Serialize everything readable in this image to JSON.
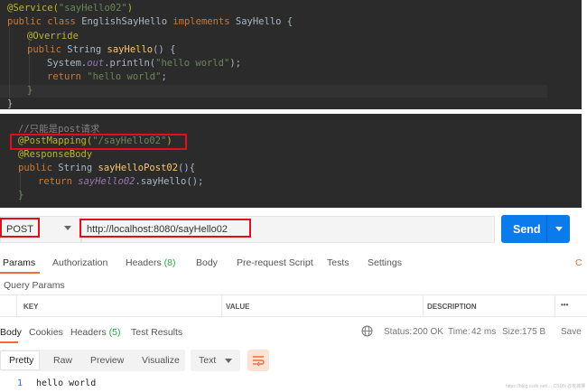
{
  "editor_top": {
    "lines": [
      {
        "anno": "@Service(",
        "str": "\"sayHello02\"",
        "tail": ")"
      },
      {
        "kw1": "public class ",
        "cls": "EnglishSayHello ",
        "kw2": "implements ",
        "iface": "SayHello {"
      },
      {
        "anno": "@Override"
      },
      {
        "kw1": "public ",
        "type": "String ",
        "fn": "sayHello",
        "tail": "() {"
      },
      {
        "pre": "System.",
        "fld": "out",
        "post": ".println(",
        "str": "\"hello world\"",
        "tail": ");"
      },
      {
        "kw1": "return ",
        "str": "\"hello world\"",
        "tail": ";"
      },
      {
        "tail": "}"
      },
      {
        "tail": "}"
      }
    ]
  },
  "editor_bottom": {
    "comment": "//只能是post请求",
    "mapping": "@PostMapping(",
    "mapping_str": "\"/sayHello02\"",
    "mapping_close": ")",
    "response_body": "@ResponseBody",
    "sig_kw": "public ",
    "sig_type": "String ",
    "sig_fn": "sayHelloPost02",
    "sig_tail": "(){",
    "ret_kw": "return ",
    "ret_fld": "sayHello02",
    "ret_tail": ".sayHello();",
    "close": "}"
  },
  "request": {
    "method": "POST",
    "url": "http://localhost:8080/sayHello02",
    "send_label": "Send"
  },
  "request_tabs": {
    "params": "Params",
    "authorization": "Authorization",
    "headers": "Headers",
    "headers_count": "(8)",
    "body": "Body",
    "prerequest": "Pre-request Script",
    "tests": "Tests",
    "settings": "Settings",
    "cookies_cut": "C"
  },
  "query_params": {
    "title": "Query Params",
    "col_key": "KEY",
    "col_value": "VALUE",
    "col_description": "DESCRIPTION",
    "more": "•••"
  },
  "response_tabs": {
    "body": "Body",
    "cookies": "Cookies",
    "headers": "Headers",
    "headers_count": "(5)",
    "test_results": "Test Results"
  },
  "response_status": {
    "status_label": "Status:",
    "status_value": "200 OK",
    "time_label": "Time:",
    "time_value": "42 ms",
    "size_label": "Size:",
    "size_value": "175 B",
    "save_cut": "Save"
  },
  "formats": {
    "pretty": "Pretty",
    "raw": "Raw",
    "preview": "Preview",
    "visualize": "Visualize",
    "text": "Text"
  },
  "response_body": {
    "line_no": "1",
    "line": "hello world"
  },
  "watermark": "https://blog.csdn.net/…  CSDN @攻城狮"
}
